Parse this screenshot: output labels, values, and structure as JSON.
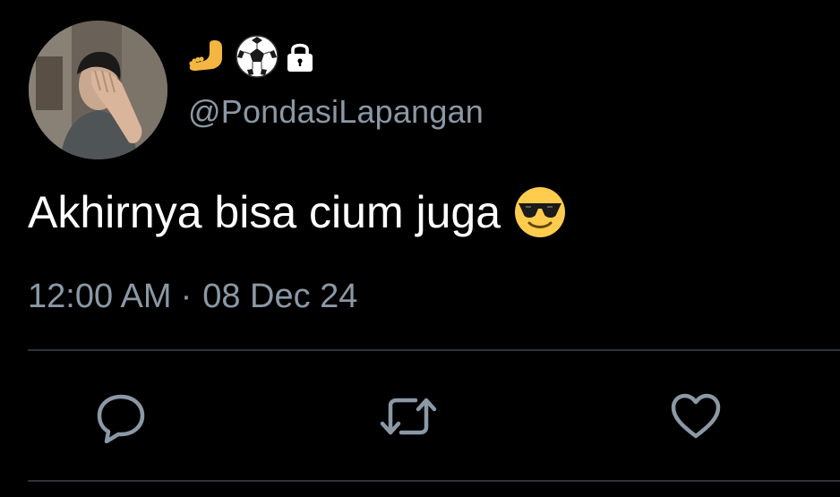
{
  "author": {
    "display_name_emojis": [
      "foot-emoji",
      "soccer-ball-emoji",
      "lock-icon"
    ],
    "handle": "@PondasiLapangan",
    "protected": true
  },
  "tweet": {
    "text": "Akhirnya bisa cium juga",
    "trailing_emoji": "smiling-face-with-sunglasses-emoji",
    "time": "12:00 AM",
    "separator": "·",
    "date": "08 Dec 24"
  },
  "actions": [
    {
      "name": "reply",
      "icon": "reply-icon"
    },
    {
      "name": "retweet",
      "icon": "retweet-icon"
    },
    {
      "name": "like",
      "icon": "heart-icon"
    }
  ],
  "colors": {
    "background": "#000000",
    "text": "#ffffff",
    "secondary_text": "#8b98a5",
    "divider": "#2f3336",
    "icon": "#8b98a5"
  }
}
